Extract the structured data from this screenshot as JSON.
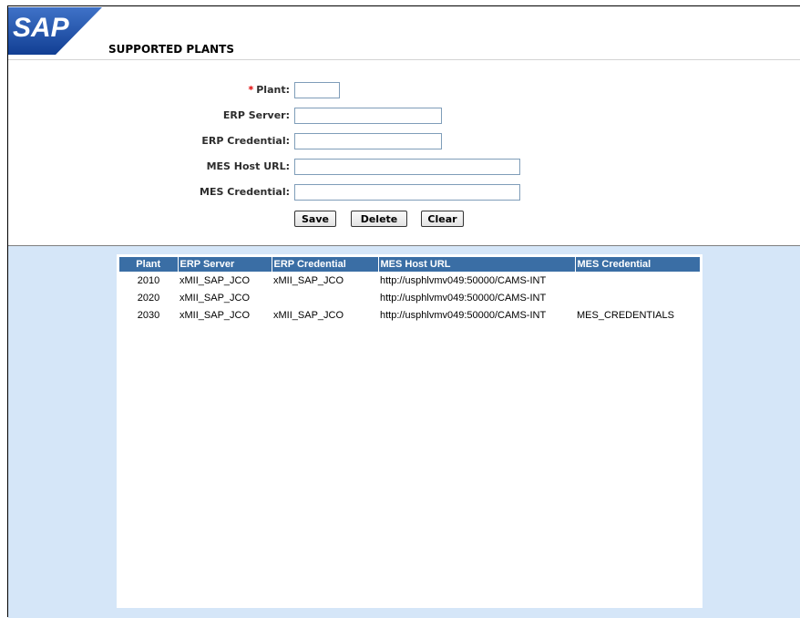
{
  "header": {
    "logo_text": "SAP",
    "title": "SUPPORTED PLANTS"
  },
  "form": {
    "plant": {
      "required_marker": "*",
      "label": "Plant:",
      "value": ""
    },
    "erp_server": {
      "label": "ERP Server:",
      "value": ""
    },
    "erp_credential": {
      "label": "ERP Credential:",
      "value": ""
    },
    "mes_host_url": {
      "label": "MES Host URL:",
      "value": ""
    },
    "mes_credential": {
      "label": "MES Credential:",
      "value": ""
    }
  },
  "buttons": {
    "save": "Save",
    "delete": "Delete",
    "clear": "Clear"
  },
  "table": {
    "columns": [
      "Plant",
      "ERP Server",
      "ERP Credential",
      "MES Host URL",
      "MES Credential"
    ],
    "rows": [
      [
        "2010",
        "xMII_SAP_JCO",
        "xMII_SAP_JCO",
        "http://usphlvmv049:50000/CAMS-INT",
        ""
      ],
      [
        "2020",
        "xMII_SAP_JCO",
        "",
        "http://usphlvmv049:50000/CAMS-INT",
        ""
      ],
      [
        "2030",
        "xMII_SAP_JCO",
        "xMII_SAP_JCO",
        "http://usphlvmv049:50000/CAMS-INT",
        "MES_CREDENTIALS"
      ]
    ]
  },
  "colors": {
    "logo_blue": "#1f4fa8",
    "table_header": "#3a6ea5",
    "panel_background": "#d5e6f8",
    "required": "#e00000"
  }
}
